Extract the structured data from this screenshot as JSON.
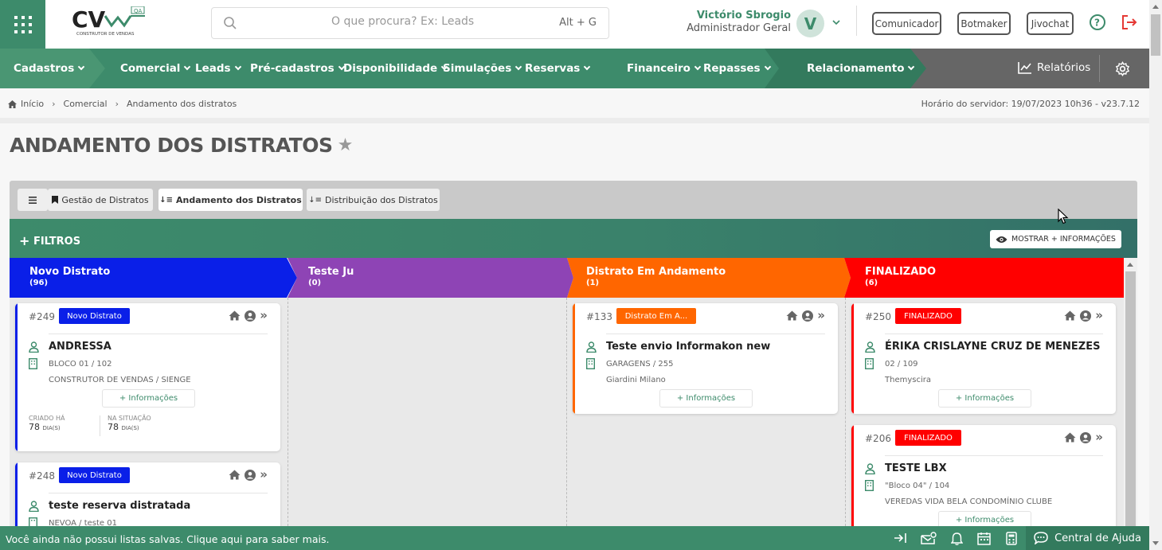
{
  "header": {
    "logo_text": "CV",
    "logo_sub": "CONSTRUTOR DE VENDAS",
    "logo_badge": "QA",
    "search": {
      "placeholder": "O que procura? Ex: Leads",
      "shortcut": "Alt + G"
    },
    "user": {
      "name": "Victório Sbrogio",
      "role": "Administrador Geral",
      "avatar_letter": "V"
    },
    "buttons": [
      "Comunicador",
      "Botmaker",
      "Jivochat"
    ]
  },
  "nav": {
    "items": [
      "Cadastros",
      "Comercial",
      "Leads",
      "Pré-cadastros",
      "Disponibilidade",
      "Simulações",
      "Reservas",
      "Financeiro",
      "Repasses",
      "Relacionamento"
    ],
    "reports": "Relatórios"
  },
  "breadcrumb": [
    "Início",
    "Comercial",
    "Andamento dos distratos"
  ],
  "server_time": "Horário do servidor: 19/07/2023 10h36 - v23.7.12",
  "page_title": "ANDAMENTO DOS DISTRATOS",
  "tabs": [
    "Gestão de Distratos",
    "Andamento dos Distratos",
    "Distribuição dos Distratos"
  ],
  "filters": {
    "label": "FILTROS",
    "more_button": "MOSTRAR + INFORMAÇÕES"
  },
  "columns": [
    {
      "name": "Novo Distrato",
      "count": "(96)",
      "color": "#0a1fe8"
    },
    {
      "name": "Teste Ju",
      "count": "(0)",
      "color": "#8e44b5"
    },
    {
      "name": "Distrato Em Andamento",
      "count": "(1)",
      "color": "#ff6600"
    },
    {
      "name": "FINALIZADO",
      "count": "(6)",
      "color": "#ff0000"
    }
  ],
  "cards": [
    {
      "num": "#249",
      "badge": "Novo Distrato",
      "name": "ANDRESSA",
      "unit": "BLOCO 01 / 102",
      "project": "CONSTRUTOR DE VENDAS / SIENGE",
      "info": "+ Informações",
      "created_label": "CRIADO HÁ",
      "created_value": "78",
      "status_label": "NA SITUAÇÃO",
      "status_value": "78",
      "unit_suffix": "DIA(S)"
    },
    {
      "num": "#248",
      "badge": "Novo Distrato",
      "name": "teste reserva distratada",
      "unit": "NEVOA / teste 01"
    },
    {
      "num": "#133",
      "badge": "Distrato Em A...",
      "name": "Teste envio Informakon new",
      "unit": "GARAGENS / 255",
      "project": "Giardini Milano",
      "info": "+ Informações"
    },
    {
      "num": "#250",
      "badge": "FINALIZADO",
      "name": "ÉRIKA CRISLAYNE CRUZ DE MENEZES",
      "unit": "02 / 109",
      "project": "Themyscira",
      "info": "+ Informações"
    },
    {
      "num": "#206",
      "badge": "FINALIZADO",
      "name": "TESTE LBX",
      "unit": "\"Bloco 04\" / 104",
      "project": "VEREDAS VIDA BELA CONDOMÍNIO CLUBE",
      "info": "+ Informações"
    }
  ],
  "bottom": {
    "message": "Você ainda não possui listas salvas. Clique aqui para saber mais.",
    "help": "Central de Ajuda"
  }
}
